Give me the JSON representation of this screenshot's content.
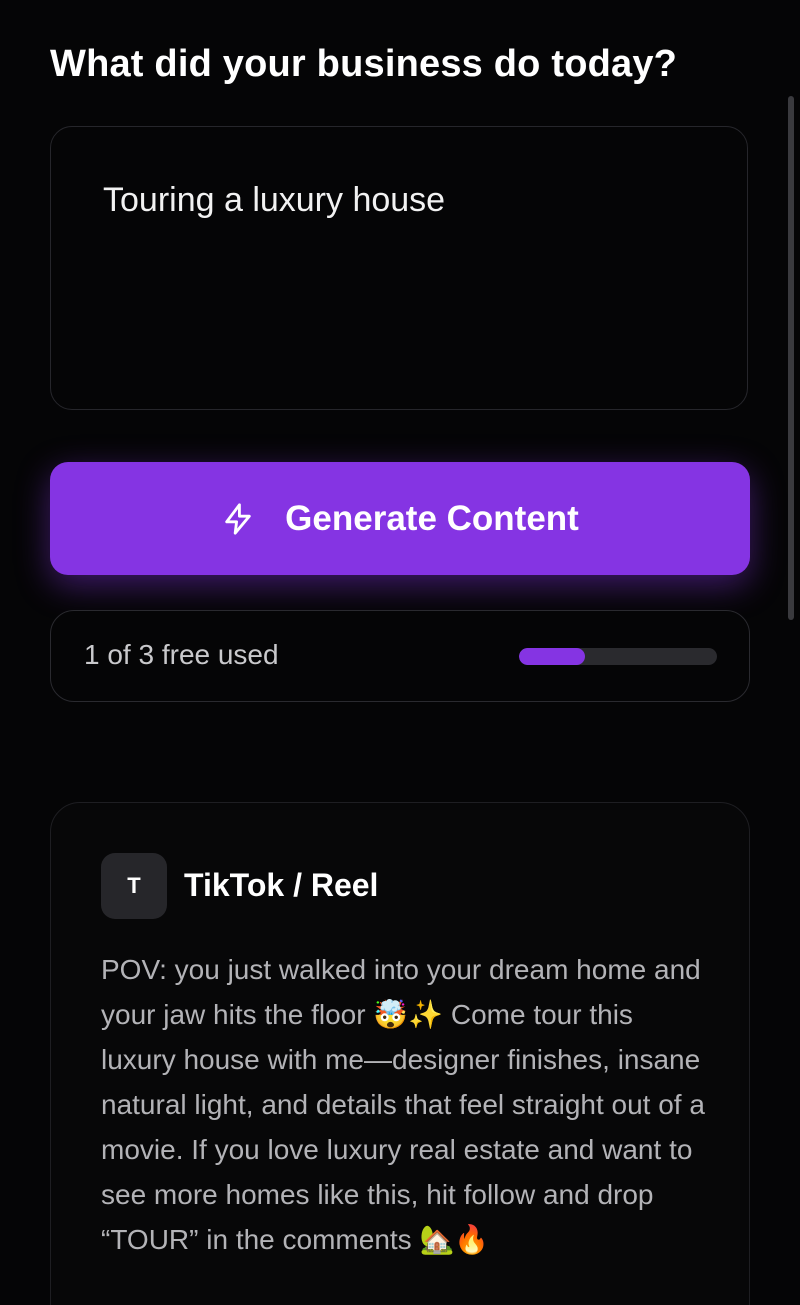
{
  "header": {
    "title": "What did your business do today?"
  },
  "prompt_input": {
    "value": "Touring a luxury house"
  },
  "generate_button": {
    "icon": "lightning-bolt-icon",
    "label": "Generate Content"
  },
  "usage": {
    "label": "1 of 3 free used",
    "used": 1,
    "total": 3,
    "progress_fraction": 0.333
  },
  "result": {
    "avatar_letter": "T",
    "platform": "TikTok / Reel",
    "body": "POV: you just walked into your dream home and your jaw hits the floor 🤯✨ Come tour this luxury house with me—designer finishes, insane natural light, and details that feel straight out of a movie. If you love luxury real estate and want to see more homes like this, hit follow and drop “TOUR” in the comments 🏡🔥"
  },
  "colors": {
    "accent": "#8534e3",
    "background": "#050506",
    "muted_text": "#b3b3b7"
  }
}
